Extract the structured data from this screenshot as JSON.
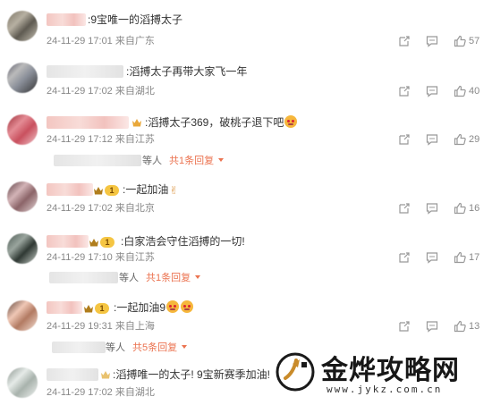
{
  "comments": [
    {
      "text": ":9宝唯一的滔搏太子",
      "meta": "24-11-29 17:01 来自广东",
      "likes": "57"
    },
    {
      "text": ":滔搏太子再带大家飞一年",
      "meta": "24-11-29 17:02 来自湖北",
      "likes": "40"
    },
    {
      "text": ":滔搏太子369，破桃子退下吧",
      "meta": "24-11-29 17:12 来自江苏",
      "likes": "29",
      "reply_who": "等人",
      "reply_more": "共1条回复"
    },
    {
      "text": ":一起加油",
      "meta": "24-11-29 17:02 来自北京",
      "likes": "16"
    },
    {
      "text": ":白家浩会守住滔搏的一切!",
      "meta": "24-11-29 17:10 来自江苏",
      "likes": "17",
      "reply_who": "等人",
      "reply_more": "共1条回复"
    },
    {
      "text": ":一起加油9",
      "meta": "24-11-29 19:31 来自上海",
      "likes": "13",
      "reply_who": "等人",
      "reply_more": "共5条回复"
    },
    {
      "text": ":滔搏唯一的太子! 9宝新赛季加油!",
      "meta": "24-11-29 17:02 来自湖北"
    }
  ],
  "badge_level": "1",
  "watermark": {
    "title": "金烨攻略网",
    "url": "www.jykz.com.cn"
  },
  "icons": {
    "share": "share-icon",
    "comment": "comment-icon",
    "like": "thumbs-up-icon"
  }
}
